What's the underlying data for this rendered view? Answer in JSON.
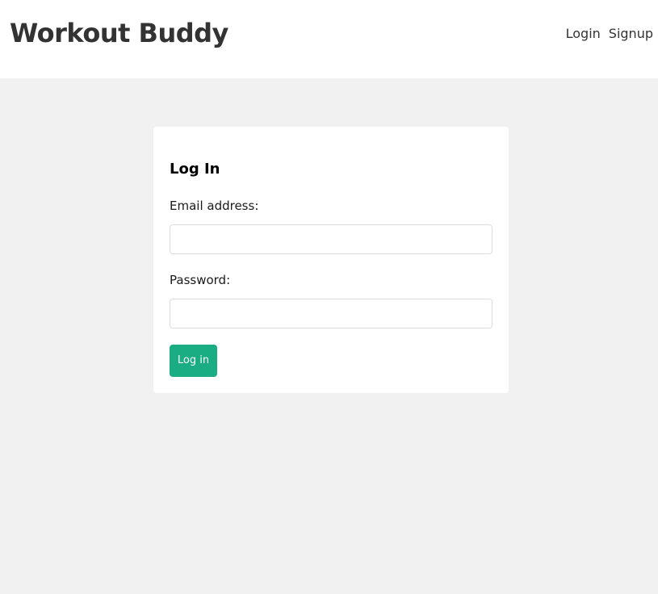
{
  "header": {
    "brand": "Workout Buddy",
    "nav": {
      "login_label": "Login",
      "signup_label": "Signup"
    }
  },
  "login_form": {
    "title": "Log In",
    "email": {
      "label": "Email address:",
      "value": "",
      "placeholder": ""
    },
    "password": {
      "label": "Password:",
      "value": "",
      "placeholder": ""
    },
    "submit_label": "Log in"
  },
  "colors": {
    "accent": "#1aac83",
    "background": "#f1f1f1",
    "header_bg": "#ffffff",
    "text": "#333333"
  }
}
